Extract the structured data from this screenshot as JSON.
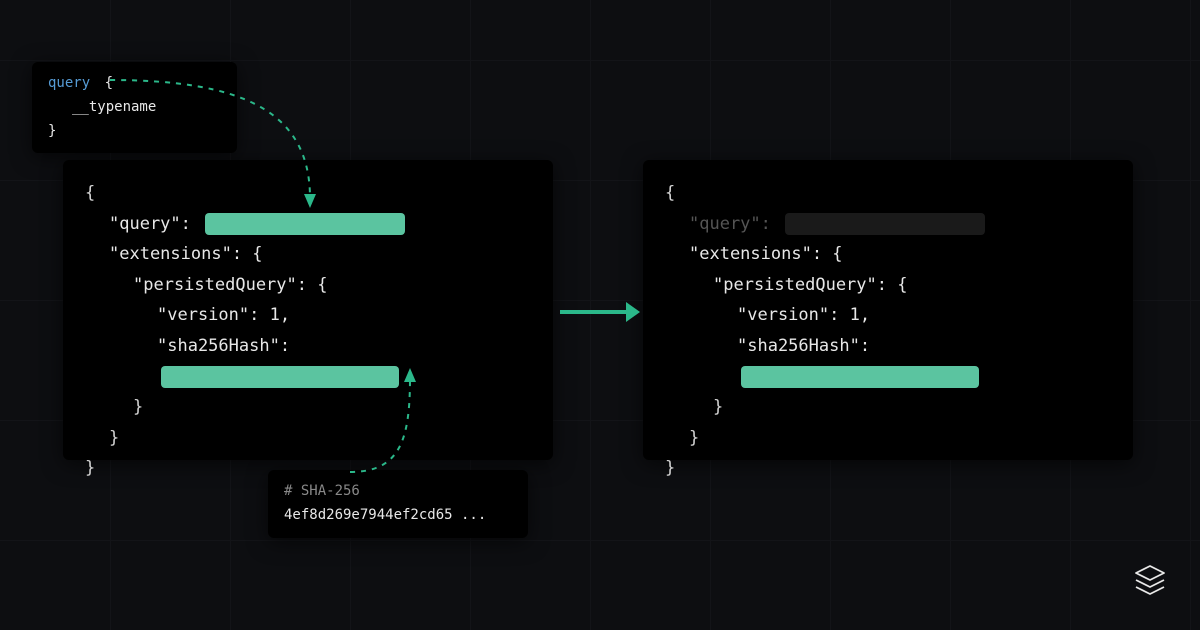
{
  "colors": {
    "accent": "#5bc4a0",
    "bg": "#0d0e11",
    "panel": "#000000"
  },
  "query_panel": {
    "keyword": "query",
    "brace_open": "{",
    "field": "__typename",
    "brace_close": "}"
  },
  "hash_panel": {
    "comment": "# SHA-256",
    "value": "4ef8d269e7944ef2cd65 ..."
  },
  "json_left": {
    "brace_open": "{",
    "query_key": "\"query\":",
    "extensions_key": "\"extensions\": {",
    "persisted_key": "\"persistedQuery\": {",
    "version_line": "\"version\": 1,",
    "hash_key": "\"sha256Hash\":",
    "brace_close": "}"
  },
  "json_right": {
    "brace_open": "{",
    "query_key": "\"query\":",
    "extensions_key": "\"extensions\": {",
    "persisted_key": "\"persistedQuery\": {",
    "version_line": "\"version\": 1,",
    "hash_key": "\"sha256Hash\":",
    "brace_close": "}"
  }
}
